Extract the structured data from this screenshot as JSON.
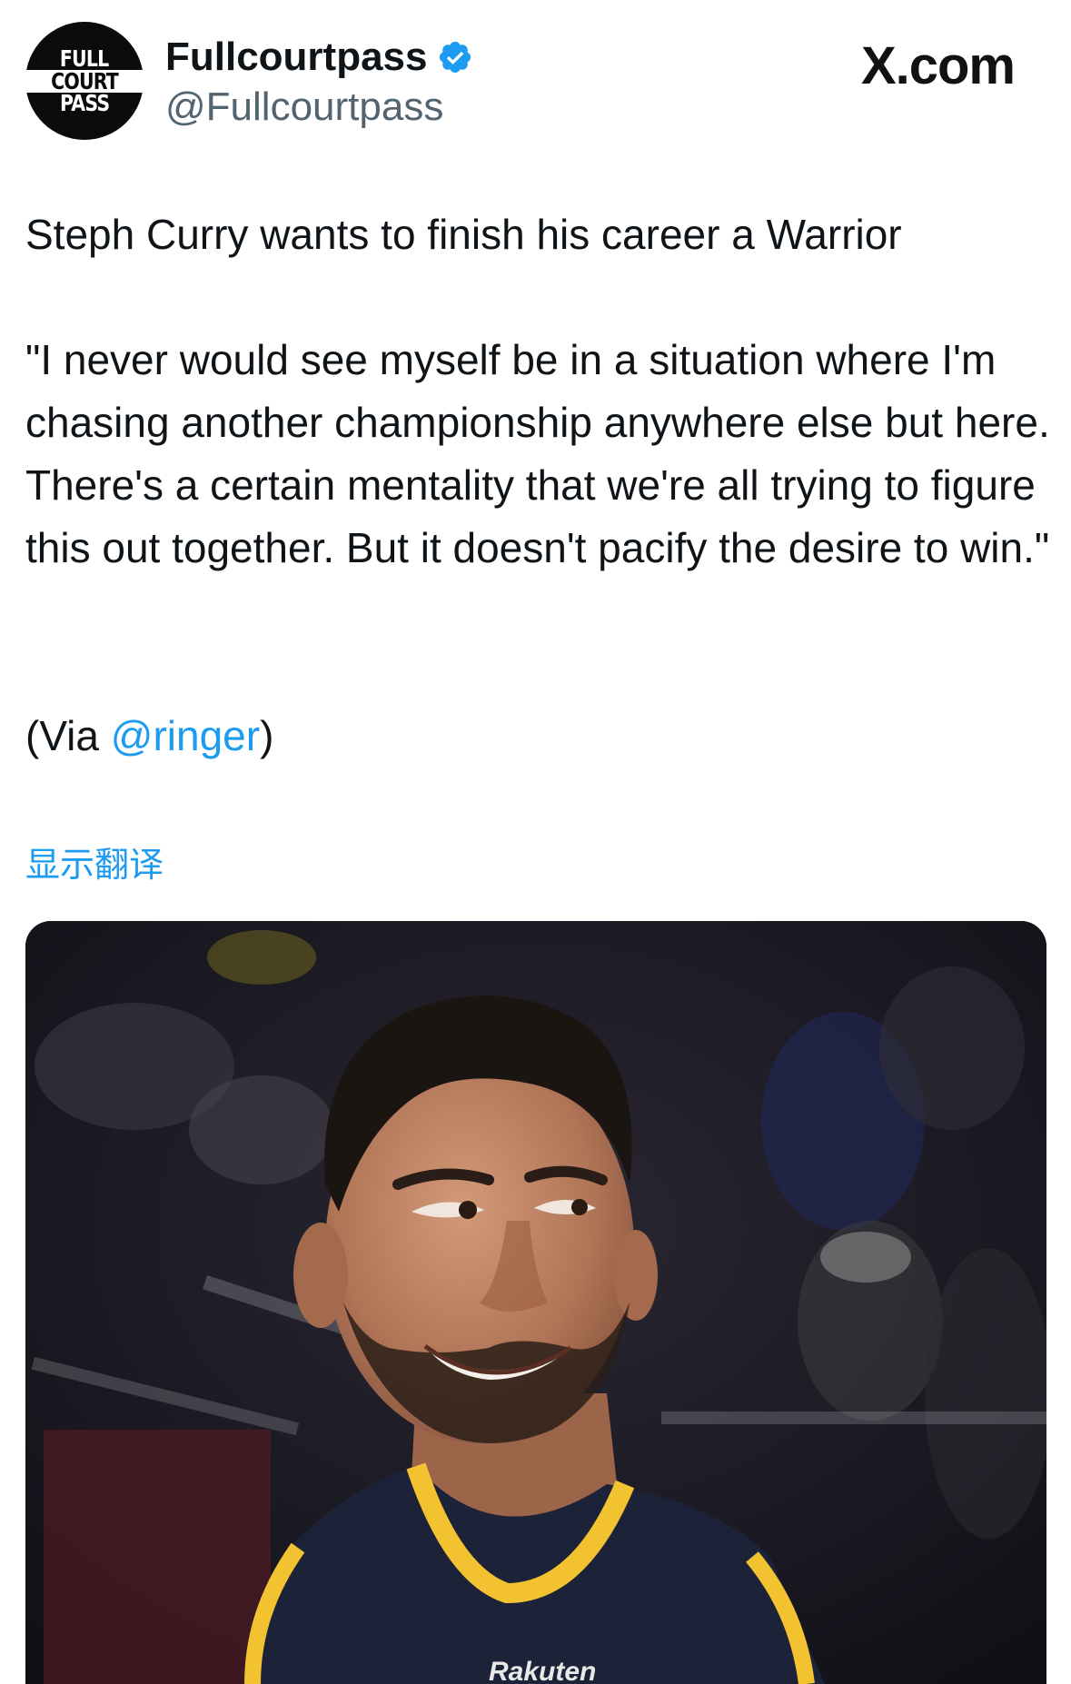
{
  "author": {
    "display_name": "Fullcourtpass",
    "handle": "@Fullcourtpass",
    "verified": true,
    "avatar_text": [
      "FULL",
      "COURT",
      "PASS"
    ],
    "avatar_icon": "basketball-logo-icon"
  },
  "site_badge": "X.com",
  "tweet": {
    "headline": "Steph Curry wants to finish his career a Warrior",
    "quote": "\"I never would see myself be in a situation where I'm chasing another championship anywhere else but here. There's a certain mentality that we're all trying to figure this out together. But it doesn't pacify the desire to win.\"",
    "via_prefix": "(Via ",
    "via_mention": "@ringer",
    "via_suffix": ")"
  },
  "translate_label": "显示翻译",
  "media": {
    "jersey_text": "Rakuten"
  },
  "colors": {
    "accent": "#1d9bf0",
    "text_primary": "#0f1419",
    "text_secondary": "#536471",
    "jersey_navy": "#1c2238",
    "jersey_gold": "#f2c230"
  }
}
